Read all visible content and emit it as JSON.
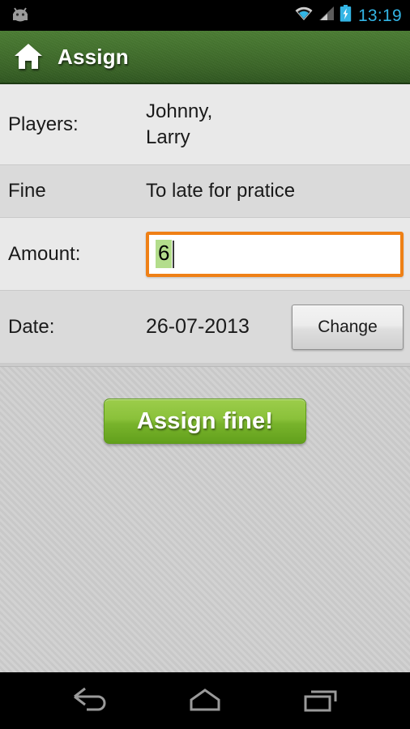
{
  "status_bar": {
    "notification_icon": "android-robot-icon",
    "wifi_icon": "wifi-icon",
    "signal_icon": "cell-signal-icon",
    "battery_icon": "battery-charging-icon",
    "clock": "13:19",
    "clock_color": "#33b5e5",
    "background": "#000000"
  },
  "action_bar": {
    "home_icon": "home-icon",
    "title": "Assign",
    "background_color": "#3a6527",
    "title_color": "#ffffff"
  },
  "form": {
    "rows": [
      {
        "label": "Players:",
        "value_line1": "Johnny,",
        "value_line2": "Larry"
      },
      {
        "label": "Fine",
        "value": "To late for pratice"
      },
      {
        "label": "Amount:",
        "value": "6"
      },
      {
        "label": "Date:",
        "value": "26-07-2013",
        "button_label": "Change"
      }
    ],
    "amount_input": {
      "value": "6",
      "focused": true,
      "border_color": "#ef8016",
      "selection_color": "#b3dd8c",
      "background": "#ffffff"
    },
    "row_bg_light": "#e9e9e9",
    "row_bg_dark": "#dadada"
  },
  "main": {
    "assign_button_label": "Assign fine!",
    "assign_button_color": "#8ac13a",
    "background_pattern": "diagonal-stripes"
  },
  "nav_bar": {
    "back_icon": "back-arrow-icon",
    "home_icon": "home-pentagon-icon",
    "recents_icon": "recent-apps-icon",
    "background": "#000000",
    "icon_color": "#9a9a9a"
  }
}
